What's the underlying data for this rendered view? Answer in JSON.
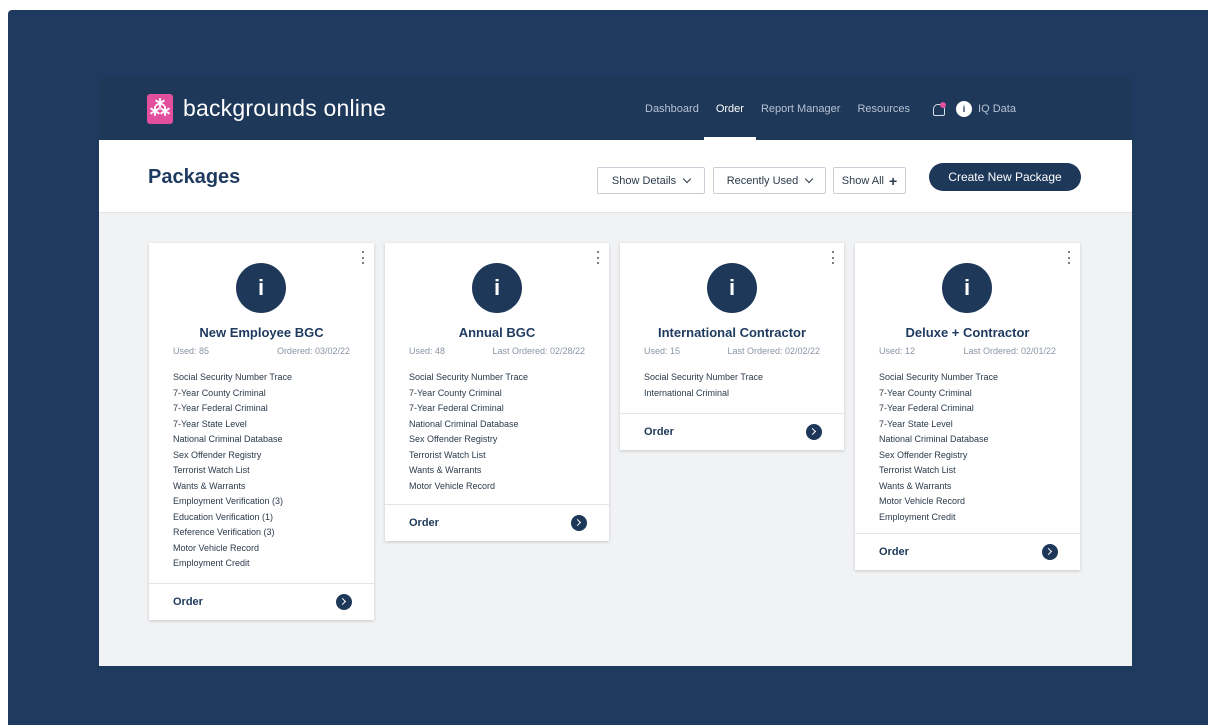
{
  "brand": {
    "mark": "⁂",
    "name": "backgrounds online"
  },
  "nav": {
    "items": [
      "Dashboard",
      "Order",
      "Report Manager",
      "Resources"
    ],
    "iq_mark": "i",
    "iq_label": "IQ Data"
  },
  "page": {
    "title": "Packages",
    "show_details": "Show Details",
    "recently_used": "Recently Used",
    "show_all": "Show All",
    "show_all_plus": "+",
    "create_button": "Create New Package"
  },
  "cards": [
    {
      "logo": "i",
      "title": "New Employee BGC",
      "used": "Used: 85",
      "ordered": "Ordered: 03/02/22",
      "items": [
        "Social Security Number Trace",
        "7-Year County Criminal",
        "7-Year Federal Criminal",
        "7-Year State Level",
        "National Criminal Database",
        "Sex Offender Registry",
        "Terrorist Watch List",
        "Wants & Warrants",
        "Employment Verification (3)",
        "Education Verification (1)",
        "Reference Verification (3)",
        "Motor Vehicle Record",
        "Employment Credit"
      ],
      "order_label": "Order"
    },
    {
      "logo": "i",
      "title": "Annual BGC",
      "used": "Used: 48",
      "ordered": "Last Ordered: 02/28/22",
      "items": [
        "Social Security Number Trace",
        "7-Year County Criminal",
        "7-Year Federal Criminal",
        "National Criminal Database",
        "Sex Offender Registry",
        "Terrorist Watch List",
        "Wants & Warrants",
        "Motor Vehicle Record"
      ],
      "order_label": "Order"
    },
    {
      "logo": "i",
      "title": "International Contractor",
      "used": "Used: 15",
      "ordered": "Last Ordered: 02/02/22",
      "items": [
        "Social Security Number Trace",
        "International Criminal"
      ],
      "order_label": "Order"
    },
    {
      "logo": "i",
      "title": "Deluxe + Contractor",
      "used": "Used: 12",
      "ordered": "Last Ordered: 02/01/22",
      "items": [
        "Social Security Number Trace",
        "7-Year County Criminal",
        "7-Year Federal Criminal",
        "7-Year State Level",
        "National Criminal Database",
        "Sex Offender Registry",
        "Terrorist Watch List",
        "Wants & Warrants",
        "Motor Vehicle Record",
        "Employment Credit"
      ],
      "order_label": "Order"
    }
  ],
  "colors": {
    "navy": "#1e3859",
    "brand_pink": "#e24f9d",
    "frame": "#1f3a5f"
  }
}
